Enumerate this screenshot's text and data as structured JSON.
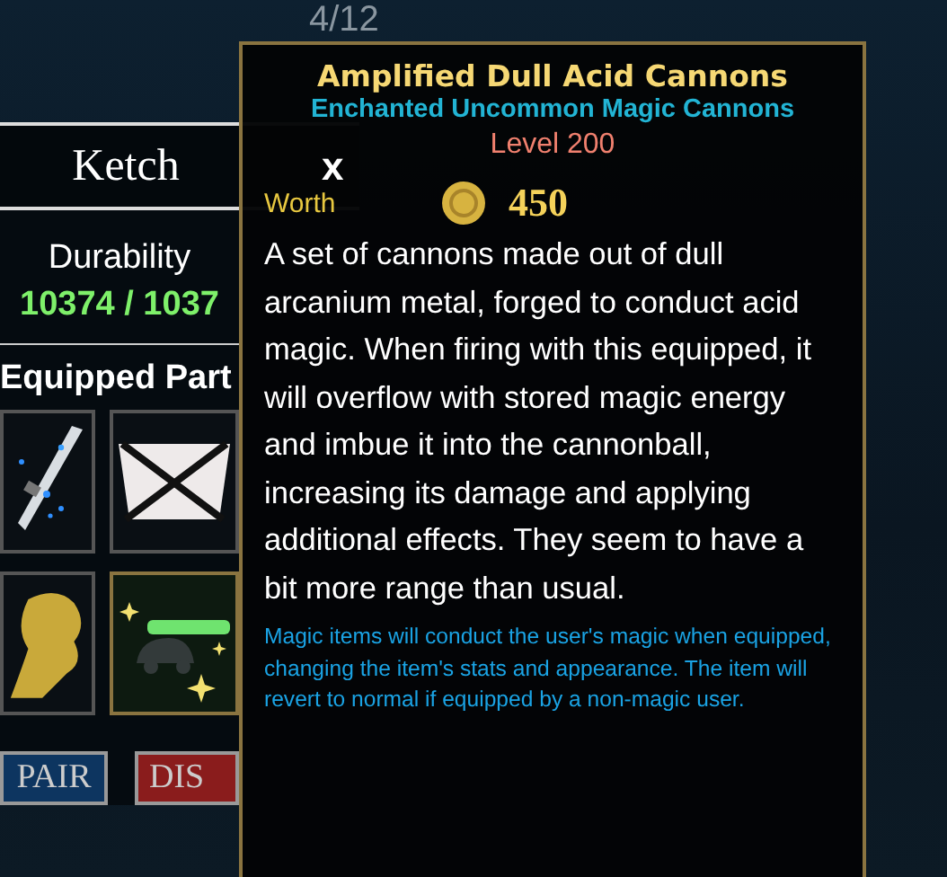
{
  "page_counter": "4/12",
  "ship_panel": {
    "title": "Ketch",
    "close": "x",
    "durability_label": "Durability",
    "durability_value": "10374 / 1037",
    "section_title": "Equipped Part",
    "parts": [
      {
        "kind": "sword",
        "selected": false
      },
      {
        "kind": "sail",
        "selected": false
      },
      {
        "kind": "figurehead",
        "selected": false
      },
      {
        "kind": "cannon",
        "selected": true
      }
    ],
    "buttons": [
      {
        "label": "PAIR",
        "kind": "repair"
      },
      {
        "label": "DIS",
        "kind": "dismiss"
      }
    ]
  },
  "tooltip": {
    "title": "Amplified Dull Acid Cannons",
    "subtitle": "Enchanted Uncommon Magic Cannons",
    "level": "Level 200",
    "worth_label": "Worth",
    "worth_value": "450",
    "description": "A set of cannons made out of dull arcanium metal, forged to conduct acid magic. When firing with this equipped, it will overflow with stored magic energy and imbue it into the cannonball, increasing its damage and applying additional effects. They seem to have a bit more range than usual.",
    "note": "Magic items will conduct the user's magic when equipped, changing the item's stats and appearance. The item will revert to normal if equipped by a non-magic user."
  }
}
